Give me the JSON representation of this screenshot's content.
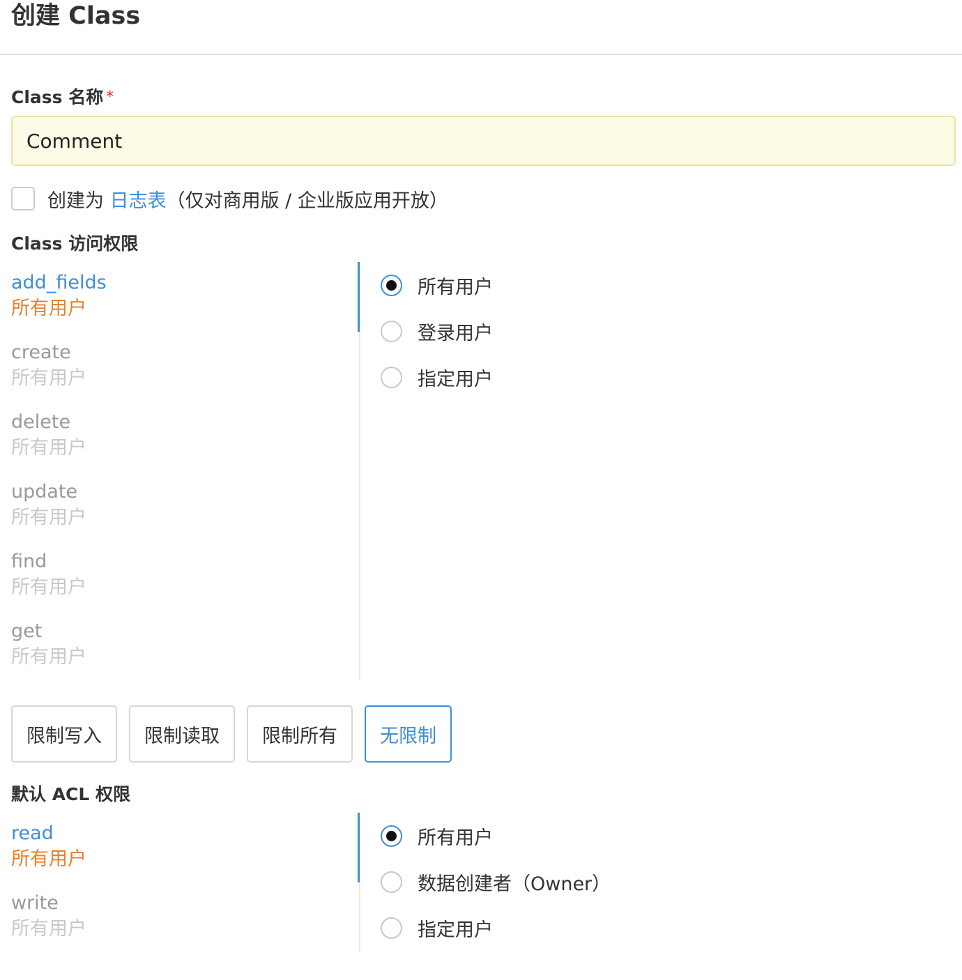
{
  "header": {
    "title": "创建 Class"
  },
  "name_field": {
    "label": "Class 名称",
    "required_mark": "*",
    "value": "Comment"
  },
  "log_option": {
    "prefix": "创建为",
    "link": "日志表",
    "suffix": "（仅对商用版 / 企业版应用开放）",
    "checked": false
  },
  "class_permissions": {
    "label": "Class 访问权限",
    "items": [
      {
        "name": "add_fields",
        "value": "所有用户",
        "active": true
      },
      {
        "name": "create",
        "value": "所有用户",
        "active": false
      },
      {
        "name": "delete",
        "value": "所有用户",
        "active": false
      },
      {
        "name": "update",
        "value": "所有用户",
        "active": false
      },
      {
        "name": "find",
        "value": "所有用户",
        "active": false
      },
      {
        "name": "get",
        "value": "所有用户",
        "active": false
      }
    ],
    "options": [
      {
        "label": "所有用户",
        "checked": true
      },
      {
        "label": "登录用户",
        "checked": false
      },
      {
        "label": "指定用户",
        "checked": false
      }
    ]
  },
  "preset_buttons": [
    {
      "label": "限制写入",
      "active": false
    },
    {
      "label": "限制读取",
      "active": false
    },
    {
      "label": "限制所有",
      "active": false
    },
    {
      "label": "无限制",
      "active": true
    }
  ],
  "acl_permissions": {
    "label": "默认 ACL 权限",
    "items": [
      {
        "name": "read",
        "value": "所有用户",
        "active": true
      },
      {
        "name": "write",
        "value": "所有用户",
        "active": false
      }
    ],
    "options": [
      {
        "label": "所有用户",
        "checked": true
      },
      {
        "label": "数据创建者（Owner）",
        "checked": false
      },
      {
        "label": "指定用户",
        "checked": false
      }
    ]
  },
  "colors": {
    "accent": "#3d8fd8",
    "active_value": "#e9802b",
    "input_bg": "#fcfbe6",
    "required": "#d9342b"
  }
}
